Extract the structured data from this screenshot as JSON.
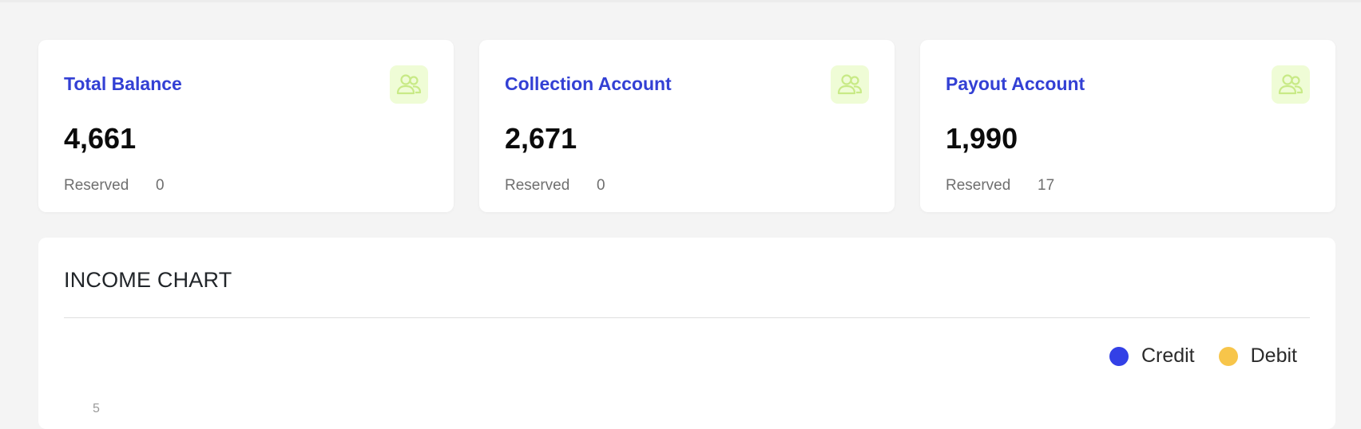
{
  "cards": [
    {
      "title": "Total Balance",
      "value": "4,661",
      "reserved_label": "Reserved",
      "reserved_value": "0",
      "icon": "users-icon"
    },
    {
      "title": "Collection Account",
      "value": "2,671",
      "reserved_label": "Reserved",
      "reserved_value": "0",
      "icon": "users-icon"
    },
    {
      "title": "Payout Account",
      "value": "1,990",
      "reserved_label": "Reserved",
      "reserved_value": "17",
      "icon": "users-icon"
    }
  ],
  "income_chart": {
    "title": "INCOME CHART",
    "legend": [
      {
        "label": "Credit",
        "color": "#3340e6"
      },
      {
        "label": "Debit",
        "color": "#f7c54a"
      }
    ],
    "y_tick_top": "5"
  },
  "colors": {
    "accent": "#3340d4",
    "icon_bg": "#effcd6",
    "icon_stroke": "#c8ea86"
  }
}
